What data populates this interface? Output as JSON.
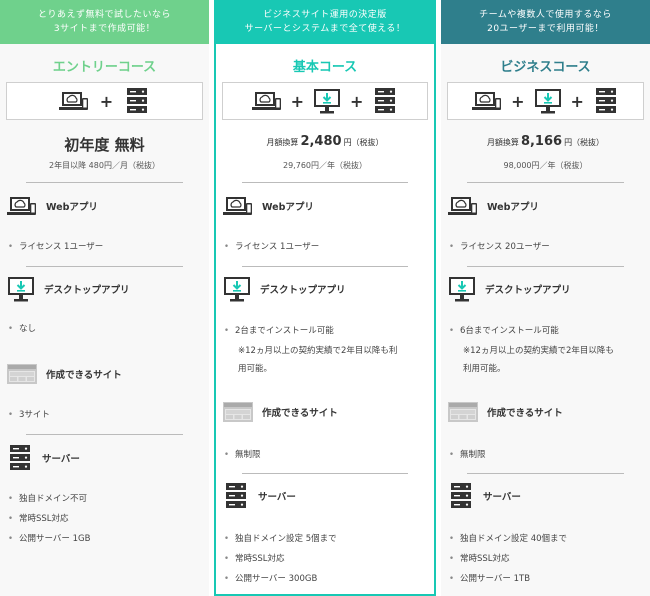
{
  "plans": [
    {
      "banner_line1": "とりあえず無料で試したいなら",
      "banner_line2": "3サイトまで作成可能！",
      "title": "エントリーコース",
      "price_big": "初年度 無料",
      "price_sub": "2年目以降 480円／月（税抜）",
      "web_label": "Webアプリ",
      "web_items": [
        "ライセンス 1ユーザー"
      ],
      "desktop_label": "デスクトップアプリ",
      "desktop_items": [
        "なし"
      ],
      "site_label": "作成できるサイト",
      "site_items": [
        "3サイト"
      ],
      "server_label": "サーバー",
      "server_items": [
        "独自ドメイン不可",
        "常時SSL対応",
        "公開サーバー 1GB"
      ]
    },
    {
      "banner_line1": "ビジネスサイト運用の決定版",
      "banner_line2": "サーバーとシステムまで全て使える！",
      "title": "基本コース",
      "monthly_prefix": "月額換算",
      "monthly_value": "2,480",
      "monthly_suffix": "円（税抜）",
      "yearly": "29,760円／年（税抜）",
      "web_label": "Webアプリ",
      "web_items": [
        "ライセンス 1ユーザー"
      ],
      "desktop_label": "デスクトップアプリ",
      "desktop_items": [
        "2台までインストール可能"
      ],
      "desktop_note_line1": "※12ヵ月以上の契約実績で2年目以降も利",
      "desktop_note_line2": "用可能。",
      "site_label": "作成できるサイト",
      "site_items": [
        "無制限"
      ],
      "server_label": "サーバー",
      "server_items": [
        "独自ドメイン設定 5個まで",
        "常時SSL対応",
        "公開サーバー 300GB"
      ]
    },
    {
      "banner_line1": "チームや複数人で使用するなら",
      "banner_line2": "20ユーザーまで利用可能！",
      "title": "ビジネスコース",
      "monthly_prefix": "月額換算",
      "monthly_value": "8,166",
      "monthly_suffix": "円（税抜）",
      "yearly": "98,000円／年（税抜）",
      "web_label": "Webアプリ",
      "web_items": [
        "ライセンス 20ユーザー"
      ],
      "desktop_label": "デスクトップアプリ",
      "desktop_items": [
        "6台までインストール可能"
      ],
      "desktop_note_line1": "※12ヵ月以上の契約実績で2年目以降も",
      "desktop_note_line2": "利用可能。",
      "site_label": "作成できるサイト",
      "site_items": [
        "無制限"
      ],
      "server_label": "サーバー",
      "server_items": [
        "独自ドメイン設定 40個まで",
        "常時SSL対応",
        "公開サーバー 1TB"
      ]
    }
  ],
  "colors": {
    "entry": "#6fd18c",
    "basic": "#18c8b4",
    "business": "#2f7f8c"
  },
  "icons": [
    "laptop-cloud-icon",
    "desktop-download-icon",
    "server-icon",
    "browser-window-icon"
  ]
}
